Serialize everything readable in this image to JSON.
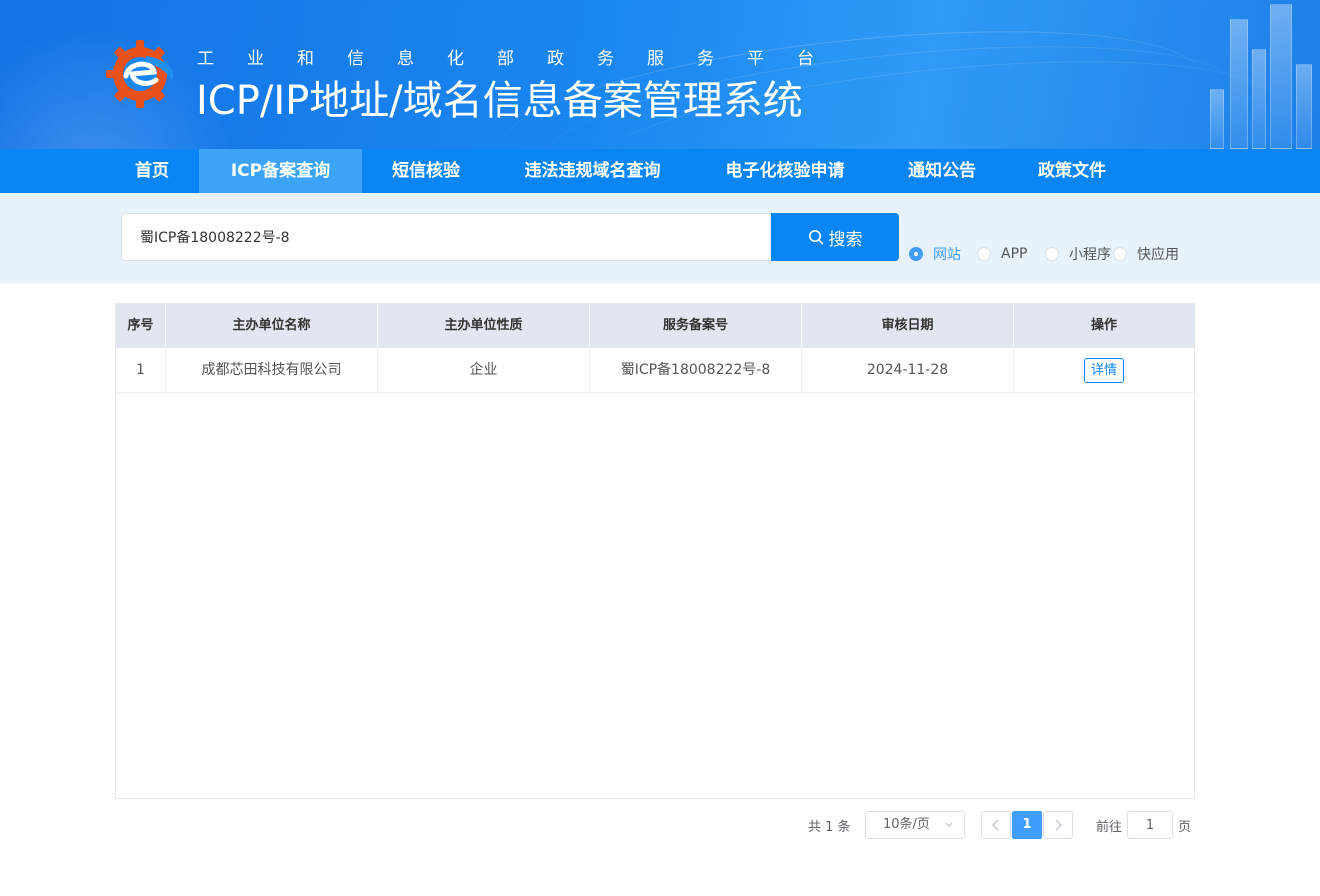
{
  "header": {
    "subtitle": "工业和信息化部政务服务平台",
    "title": "ICP/IP地址/域名信息备案管理系统"
  },
  "nav": {
    "items": [
      {
        "label": "首页"
      },
      {
        "label": "ICP备案查询",
        "active": true
      },
      {
        "label": "短信核验"
      },
      {
        "label": "违法违规域名查询"
      },
      {
        "label": "电子化核验申请"
      },
      {
        "label": "通知公告"
      },
      {
        "label": "政策文件"
      }
    ]
  },
  "search": {
    "value": "蜀ICP备18008222号-8",
    "button_label": "搜索",
    "types": [
      {
        "label": "网站",
        "checked": true
      },
      {
        "label": "APP",
        "checked": false
      },
      {
        "label": "小程序",
        "checked": false
      },
      {
        "label": "快应用",
        "checked": false
      }
    ]
  },
  "table": {
    "headers": [
      "序号",
      "主办单位名称",
      "主办单位性质",
      "服务备案号",
      "审核日期",
      "操作"
    ],
    "rows": [
      {
        "index": "1",
        "org_name": "成都芯田科技有限公司",
        "org_type": "企业",
        "record_no": "蜀ICP备18008222号-8",
        "review_date": "2024-11-28",
        "action_label": "详情"
      }
    ]
  },
  "pagination": {
    "total_text": "共 1 条",
    "page_size": "10条/页",
    "current_page": "1",
    "goto_prefix": "前往",
    "goto_value": "1",
    "goto_suffix": "页"
  },
  "colors": {
    "brand_blue": "#0a85f6",
    "nav_active": "#3ba3f8",
    "accent": "#409eff",
    "search_band": "#e8f2fd"
  },
  "icons": {
    "logo": "miit-logo-icon",
    "search": "search-icon",
    "prev": "chevron-left-icon",
    "next": "chevron-right-icon",
    "dropdown": "chevron-down-icon"
  }
}
